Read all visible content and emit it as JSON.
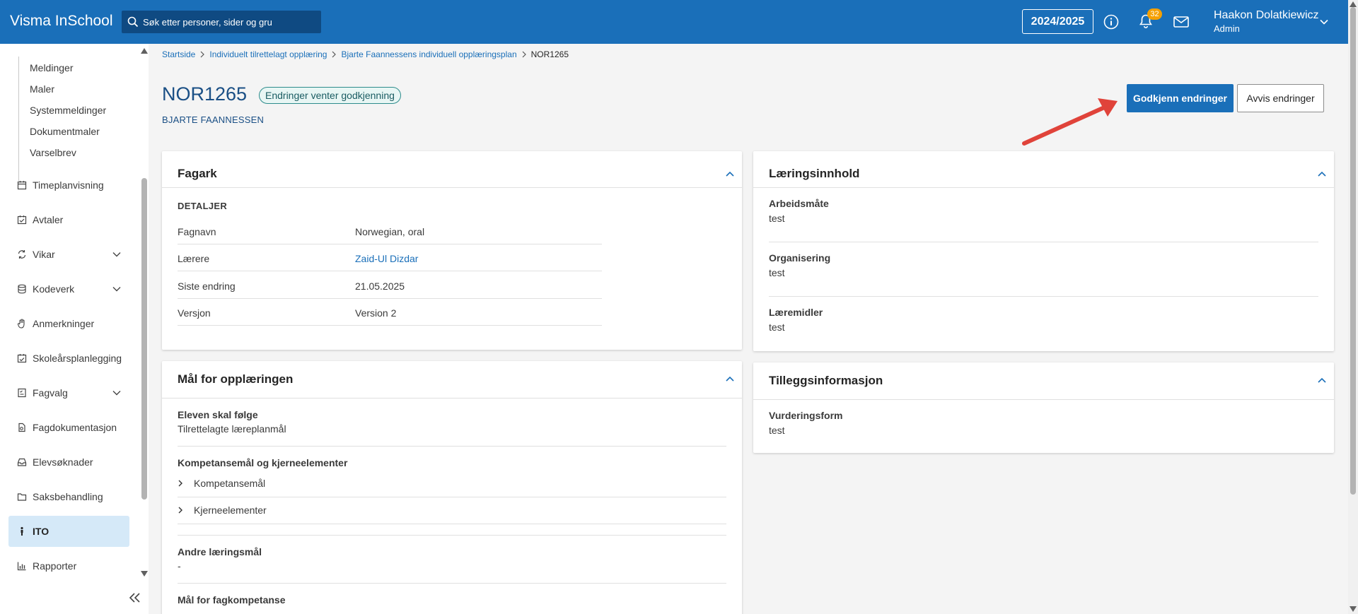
{
  "header": {
    "brand": "Visma InSchool",
    "search_placeholder": "Søk etter personer, sider og gru",
    "school_year": "2024/2025",
    "notification_count": "32",
    "user_name": "Haakon Dolatkiewicz",
    "user_role": "Admin",
    "bar_color": "#1a6fb9"
  },
  "sidebar": {
    "sub_items": [
      "Meldinger",
      "Maler",
      "Systemmeldinger",
      "Dokumentmaler",
      "Varselbrev"
    ],
    "items": [
      {
        "label": "Timeplanvisning",
        "icon": "calendar-icon",
        "expandable": false
      },
      {
        "label": "Avtaler",
        "icon": "calendar-check-icon",
        "expandable": false
      },
      {
        "label": "Vikar",
        "icon": "swap-icon",
        "expandable": true
      },
      {
        "label": "Kodeverk",
        "icon": "database-icon",
        "expandable": true
      },
      {
        "label": "Anmerkninger",
        "icon": "hand-icon",
        "expandable": false
      },
      {
        "label": "Skoleårsplanlegging",
        "icon": "calendar-plan-icon",
        "expandable": false
      },
      {
        "label": "Fagvalg",
        "icon": "checklist-icon",
        "expandable": true
      },
      {
        "label": "Fagdokumentasjon",
        "icon": "document-icon",
        "expandable": false
      },
      {
        "label": "Elevsøknader",
        "icon": "inbox-icon",
        "expandable": false
      },
      {
        "label": "Saksbehandling",
        "icon": "folder-icon",
        "expandable": false
      },
      {
        "label": "ITO",
        "icon": "person-icon",
        "expandable": false,
        "active": true
      },
      {
        "label": "Rapporter",
        "icon": "bar-chart-icon",
        "expandable": false
      }
    ]
  },
  "breadcrumb": [
    "Startside",
    "Individuelt tilrettelagt opplæring",
    "Bjarte Faannessens individuell opplæringsplan",
    "NOR1265"
  ],
  "page": {
    "title": "NOR1265",
    "status_badge": "Endringer venter godkjenning",
    "student_name": "BJARTE FAANNESSEN",
    "approve_button": "Godkjenn endringer",
    "reject_button": "Avvis endringer",
    "annotation_arrow_color": "#e0433a"
  },
  "fagark": {
    "title": "Fagark",
    "section": "DETALJER",
    "rows": [
      {
        "label": "Fagnavn",
        "value": "Norwegian, oral"
      },
      {
        "label": "Lærere",
        "value": "Zaid-Ul Dizdar"
      },
      {
        "label": "Siste endring",
        "value": "21.05.2025"
      },
      {
        "label": "Versjon",
        "value": "Version 2"
      }
    ]
  },
  "maal": {
    "title": "Mål for opplæringen",
    "follow_label": "Eleven skal følge",
    "follow_value": "Tilrettelagte læreplanmål",
    "kompetanse_label": "Kompetansemål og kjerneelementer",
    "expand_items": [
      "Kompetansemål",
      "Kjerneelementer"
    ],
    "andre_label": "Andre læringsmål",
    "andre_value": "-",
    "fagkompetanse_label": "Mål for fagkompetanse"
  },
  "laeringsinnhold": {
    "title": "Læringsinnhold",
    "items": [
      {
        "label": "Arbeidsmåte",
        "value": "test"
      },
      {
        "label": "Organisering",
        "value": "test"
      },
      {
        "label": "Læremidler",
        "value": "test"
      }
    ]
  },
  "tilleggsinfo": {
    "title": "Tilleggsinformasjon",
    "items": [
      {
        "label": "Vurderingsform",
        "value": "test"
      }
    ]
  }
}
